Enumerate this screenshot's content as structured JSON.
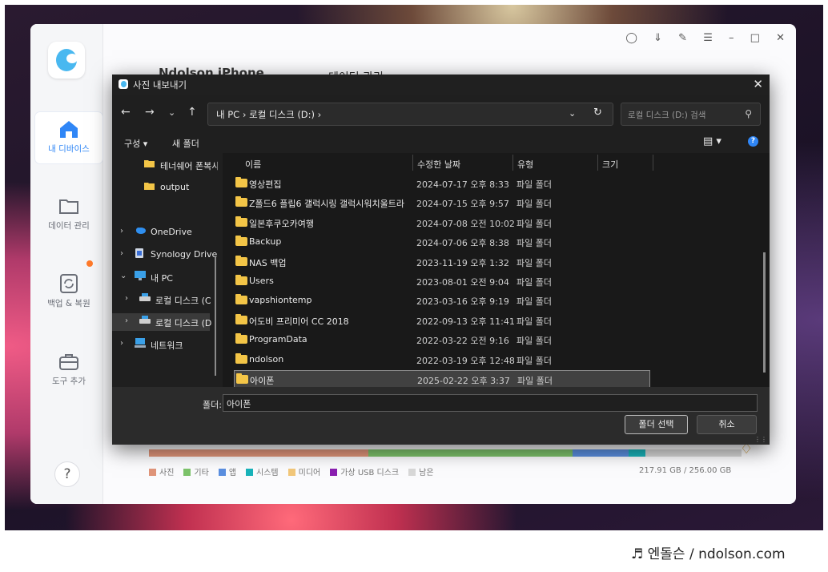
{
  "app": {
    "device_title": "Ndolson iPhone",
    "tab_data": "데이터 관리",
    "sidebar": [
      {
        "label": "내 디바이스",
        "icon": "home-icon"
      },
      {
        "label": "데이터 관리",
        "icon": "folder-icon"
      },
      {
        "label": "백업 & 복원",
        "icon": "backup-restore-icon"
      },
      {
        "label": "도구 추가",
        "icon": "toolbox-icon"
      }
    ],
    "help_label": "?",
    "storage": {
      "used_text": "217.91 GB / 256.00 GB",
      "legend": [
        {
          "label": "사진",
          "color": "#e0957a"
        },
        {
          "label": "기타",
          "color": "#7dc36b"
        },
        {
          "label": "앱",
          "color": "#5b8fe0"
        },
        {
          "label": "시스템",
          "color": "#19b3ba"
        },
        {
          "label": "미디어",
          "color": "#f2c77a"
        },
        {
          "label": "가상 USB 디스크",
          "color": "#8a1fb0"
        },
        {
          "label": "남은",
          "color": "#d8d8d8"
        }
      ],
      "segments_percent": [
        {
          "color": "#e0957a",
          "value": 37
        },
        {
          "color": "#7dc36b",
          "value": 34.5
        },
        {
          "color": "#5b8fe0",
          "value": 9.5
        },
        {
          "color": "#19b3ba",
          "value": 2.8
        },
        {
          "color": "#d8d8d8",
          "value": 16.2
        }
      ]
    }
  },
  "dialog": {
    "title": "사진 내보내기",
    "address": "내 PC  ›  로컬 디스크 (D:)  ›",
    "search_placeholder": "로컬 디스크 (D:) 검색",
    "toolbar": {
      "organize": "구성 ▾",
      "new_folder": "새 폴더"
    },
    "tree": [
      {
        "label": "테너쉐어 폰복사",
        "chev": "",
        "icon": "folder",
        "indent": 2
      },
      {
        "label": "output",
        "chev": "",
        "icon": "folder",
        "indent": 2
      },
      {
        "label": "OneDrive",
        "chev": "›",
        "icon": "cloud",
        "indent": 0
      },
      {
        "label": "Synology Drive",
        "chev": "›",
        "icon": "synology",
        "indent": 0
      },
      {
        "label": "내 PC",
        "chev": "⌄",
        "icon": "pc",
        "indent": 0
      },
      {
        "label": "로컬 디스크 (C",
        "chev": "›",
        "icon": "drive",
        "indent": 1
      },
      {
        "label": "로컬 디스크 (D",
        "chev": "›",
        "icon": "drive",
        "indent": 1,
        "selected": true
      },
      {
        "label": "네트워크",
        "chev": "›",
        "icon": "network",
        "indent": 0
      }
    ],
    "columns": [
      "이름",
      "수정한 날짜",
      "유형",
      "크기"
    ],
    "files": [
      {
        "name": "영상편집",
        "date": "2024-07-17 오후 8:33",
        "type": "파일 폴더"
      },
      {
        "name": "Z폴드6 플립6 갤럭시링 갤럭시워치울트라",
        "date": "2024-07-15 오후 9:57",
        "type": "파일 폴더"
      },
      {
        "name": "일본후쿠오카여행",
        "date": "2024-07-08 오전 10:02",
        "type": "파일 폴더"
      },
      {
        "name": "Backup",
        "date": "2024-07-06 오후 8:38",
        "type": "파일 폴더"
      },
      {
        "name": "NAS 백업",
        "date": "2023-11-19 오후 1:32",
        "type": "파일 폴더"
      },
      {
        "name": "Users",
        "date": "2023-08-01 오전 9:04",
        "type": "파일 폴더"
      },
      {
        "name": "vapshiontemp",
        "date": "2023-03-16 오후 9:19",
        "type": "파일 폴더"
      },
      {
        "name": "어도비 프리미어 CC 2018",
        "date": "2022-09-13 오후 11:41",
        "type": "파일 폴더"
      },
      {
        "name": "ProgramData",
        "date": "2022-03-22 오전 9:16",
        "type": "파일 폴더"
      },
      {
        "name": "ndolson",
        "date": "2022-03-19 오후 12:48",
        "type": "파일 폴더"
      },
      {
        "name": "아이폰",
        "date": "2025-02-22 오후 3:37",
        "type": "파일 폴더",
        "selected": true
      }
    ],
    "folder_label": "폴더:",
    "folder_value": "아이폰",
    "ok_label": "폴더 선택",
    "cancel_label": "취소"
  },
  "caption": "♬ 엔돌슨 / ndolson.com"
}
